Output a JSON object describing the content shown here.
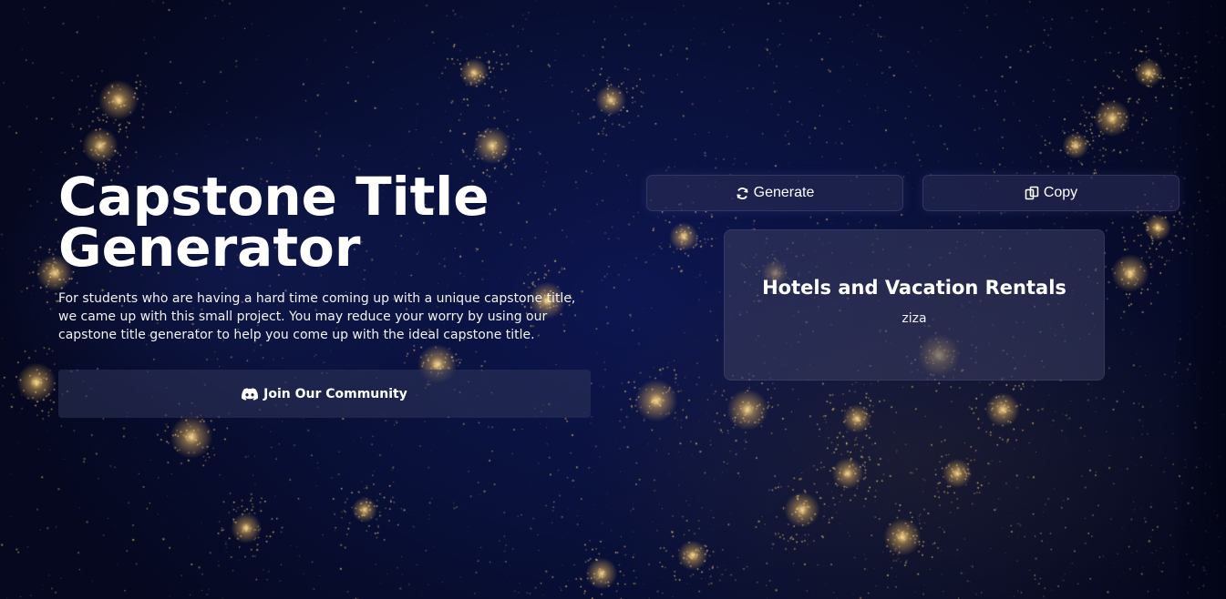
{
  "hero": {
    "title": "Capstone Title Generator",
    "description": "For students who are having a hard time coming up with a unique capstone title, we came up with this small project. You may reduce your worry by using our capstone title generator to help you come up with the ideal capstone title.",
    "community_button": {
      "label": "Join Our Community",
      "icon": "discord-icon"
    }
  },
  "actions": {
    "generate": {
      "label": "Generate",
      "icon": "refresh-icon"
    },
    "copy": {
      "label": "Copy",
      "icon": "copy-icon"
    }
  },
  "result": {
    "title": "Hotels and Vacation Rentals",
    "subtitle": "ziza"
  },
  "colors": {
    "background": "#091038",
    "city_lights": "#ffd27a",
    "panel": "#2c3058"
  }
}
